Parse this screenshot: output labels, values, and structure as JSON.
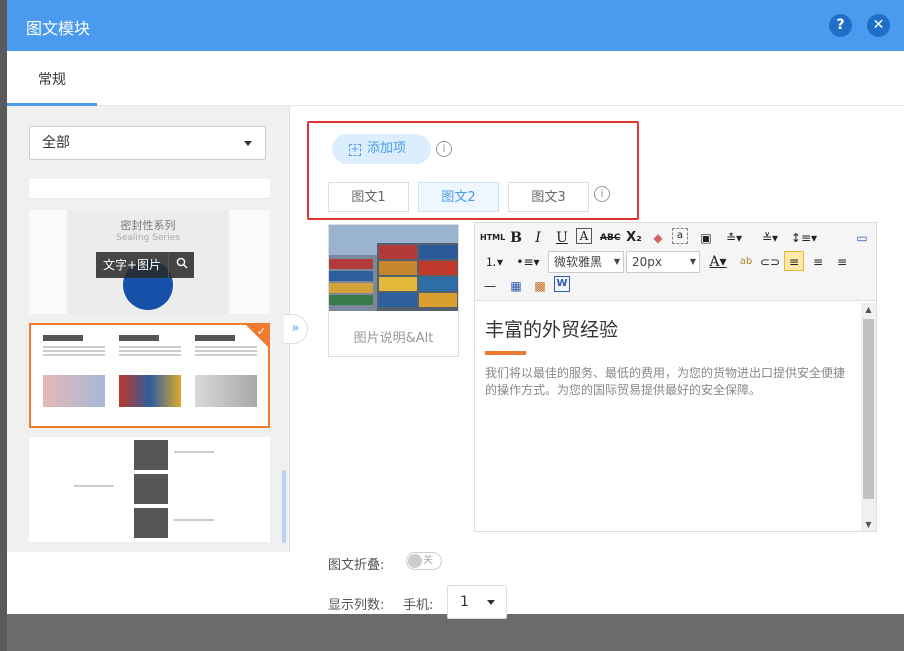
{
  "dialog": {
    "title": "图文模块",
    "help": "?",
    "close": "✕"
  },
  "tabs": [
    {
      "label": "常规"
    }
  ],
  "filter": {
    "value": "全部"
  },
  "templates": {
    "sealing_title": "密封性系列",
    "sealing_sub": "Sealing Series",
    "hover_label": "文字+图片"
  },
  "toolbar": {
    "add_item_label": "添加项",
    "item_tabs": [
      "图文1",
      "图文2",
      "图文3"
    ],
    "font_family": "微软雅黑",
    "font_size": "20px"
  },
  "editor": {
    "image_caption": "图片说明&Alt",
    "heading": "丰富的外贸经验",
    "paragraph": "我们将以最佳的服务、最低的费用，为您的货物进出口提供安全便捷的操作方式。为您的国际贸易提供最好的安全保障。"
  },
  "options": {
    "fold_label": "图文折叠:",
    "fold_toggle": "关",
    "columns_label": "显示列数:",
    "mobile_label": "手机:",
    "mobile_value": "1"
  },
  "colors": {
    "accent": "#4a9bf0",
    "selected": "#f07a2e",
    "highlight": "#e23232"
  }
}
